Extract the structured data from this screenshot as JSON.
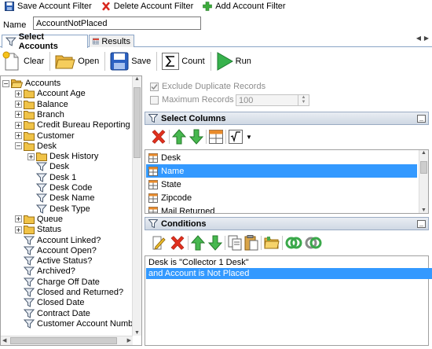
{
  "topbar": {
    "save_filter": "Save Account Filter",
    "delete_filter": "Delete Account Filter",
    "add_filter": "Add Account Filter"
  },
  "name_field": {
    "label": "Name",
    "value": "AccountNotPlaced"
  },
  "tabs": [
    {
      "label": "Select Accounts",
      "active": true
    },
    {
      "label": "Results",
      "active": false
    }
  ],
  "toolbar": {
    "clear": "Clear",
    "open": "Open",
    "save": "Save",
    "count": "Count",
    "run": "Run"
  },
  "tree": {
    "root": "Accounts",
    "items": [
      {
        "label": "Account Age",
        "kind": "folder",
        "level": 1,
        "expander": "+"
      },
      {
        "label": "Balance",
        "kind": "folder",
        "level": 1,
        "expander": "+"
      },
      {
        "label": "Branch",
        "kind": "folder",
        "level": 1,
        "expander": "+"
      },
      {
        "label": "Credit Bureau Reporting",
        "kind": "folder",
        "level": 1,
        "expander": "+"
      },
      {
        "label": "Customer",
        "kind": "folder",
        "level": 1,
        "expander": "+"
      },
      {
        "label": "Desk",
        "kind": "folder",
        "level": 1,
        "expander": "-"
      },
      {
        "label": "Desk History",
        "kind": "folder",
        "level": 2,
        "expander": "+"
      },
      {
        "label": "Desk",
        "kind": "filter",
        "level": 2,
        "selected": true
      },
      {
        "label": "Desk 1",
        "kind": "filter",
        "level": 2
      },
      {
        "label": "Desk Code",
        "kind": "filter",
        "level": 2
      },
      {
        "label": "Desk Name",
        "kind": "filter",
        "level": 2
      },
      {
        "label": "Desk Type",
        "kind": "filter",
        "level": 2
      },
      {
        "label": "Queue",
        "kind": "folder",
        "level": 1,
        "expander": "+"
      },
      {
        "label": "Status",
        "kind": "folder",
        "level": 1,
        "expander": "+"
      },
      {
        "label": "Account Linked?",
        "kind": "filter",
        "level": 1
      },
      {
        "label": "Account Open?",
        "kind": "filter",
        "level": 1
      },
      {
        "label": "Active Status?",
        "kind": "filter",
        "level": 1
      },
      {
        "label": "Archived?",
        "kind": "filter",
        "level": 1
      },
      {
        "label": "Charge Off Date",
        "kind": "filter",
        "level": 1
      },
      {
        "label": "Closed and Returned?",
        "kind": "filter",
        "level": 1
      },
      {
        "label": "Closed Date",
        "kind": "filter",
        "level": 1
      },
      {
        "label": "Contract Date",
        "kind": "filter",
        "level": 1
      },
      {
        "label": "Customer Account Number",
        "kind": "filter",
        "level": 1
      }
    ]
  },
  "options": {
    "exclude_duplicates": "Exclude Duplicate Records",
    "max_records": "Maximum Records",
    "max_records_value": "100"
  },
  "select_columns": {
    "title": "Select Columns",
    "items": [
      {
        "label": "Desk",
        "selected": false
      },
      {
        "label": "Name",
        "selected": true
      },
      {
        "label": "State",
        "selected": false
      },
      {
        "label": "Zipcode",
        "selected": false
      },
      {
        "label": "Mail Returned",
        "selected": false
      }
    ]
  },
  "conditions": {
    "title": "Conditions",
    "items": [
      {
        "label": "Desk is \"Collector 1 Desk\"",
        "selected": false
      },
      {
        "label": "and Account is Not Placed",
        "selected": true
      }
    ]
  },
  "colors": {
    "selection": "#3399ff",
    "header_border": "#9aabc3",
    "green": "#2fa84f",
    "red": "#e0301e"
  }
}
